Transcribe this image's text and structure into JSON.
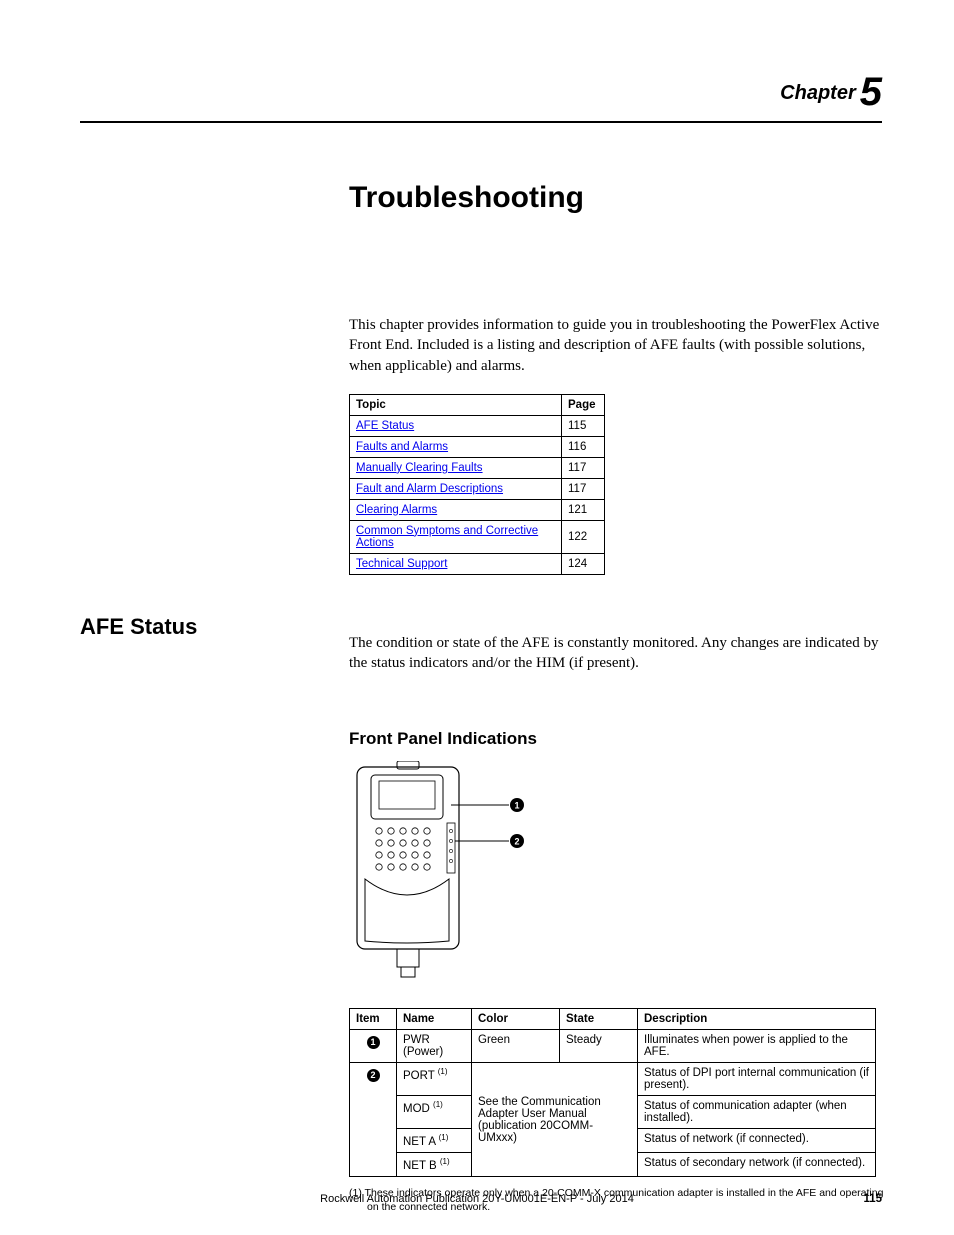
{
  "chapter": {
    "label": "Chapter",
    "number": "5"
  },
  "title": "Troubleshooting",
  "intro": "This chapter provides information to guide you in troubleshooting the PowerFlex Active Front End. Included is a listing and description of AFE faults (with possible solutions, when applicable) and alarms.",
  "topic_table": {
    "headers": {
      "topic": "Topic",
      "page": "Page"
    },
    "rows": [
      {
        "topic": "AFE Status",
        "page": "115"
      },
      {
        "topic": "Faults and Alarms",
        "page": "116"
      },
      {
        "topic": "Manually Clearing Faults",
        "page": "117"
      },
      {
        "topic": "Fault and Alarm Descriptions",
        "page": "117"
      },
      {
        "topic": "Clearing Alarms",
        "page": "121"
      },
      {
        "topic": "Common Symptoms and Corrective Actions",
        "page": "122"
      },
      {
        "topic": "Technical Support",
        "page": "124"
      }
    ]
  },
  "sidehead": "AFE Status",
  "afe_body": "The condition or state of the AFE is constantly monitored. Any changes are indicated by the status indicators and/or the HIM (if present).",
  "subhead": "Front Panel Indications",
  "callouts": {
    "c1": "1",
    "c2": "2"
  },
  "ind_table": {
    "headers": {
      "item": "Item",
      "name": "Name",
      "color": "Color",
      "state": "State",
      "desc": "Description"
    },
    "rows": [
      {
        "item": "1",
        "name": "PWR (Power)",
        "color": "Green",
        "state": "Steady",
        "desc": "Illuminates when power is applied to the AFE."
      },
      {
        "item": "2",
        "name": "PORT",
        "sup": "(1)",
        "desc": "Status of DPI port internal communication (if present)."
      },
      {
        "name": "MOD",
        "sup": "(1)",
        "desc": "Status of communication adapter (when installed)."
      },
      {
        "name": "NET A",
        "sup": "(1)",
        "desc": "Status of network (if connected)."
      },
      {
        "name": "NET B",
        "sup": "(1)",
        "desc": "Status of secondary network (if connected)."
      }
    ],
    "merged_colstate": "See the Communication Adapter User Manual (publication 20COMM-UMxxx)"
  },
  "footnote": "(1)   These indicators operate only when a 20-COMM-X communication adapter is installed in the AFE and operating on the connected network.",
  "footer": {
    "pub": "Rockwell Automation Publication 20Y-UM001E-EN-P - July 2014",
    "page": "115"
  }
}
